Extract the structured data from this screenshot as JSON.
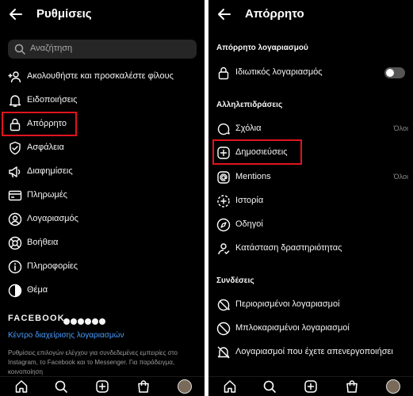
{
  "left": {
    "title": "Ρυθμίσεις",
    "search_placeholder": "Αναζήτηση",
    "items": [
      {
        "label": "Ακολουθήστε και προσκαλέστε φίλους",
        "icon": "add-person-icon"
      },
      {
        "label": "Ειδοποιήσεις",
        "icon": "bell-icon"
      },
      {
        "label": "Απόρρητο",
        "icon": "lock-icon"
      },
      {
        "label": "Ασφάλεια",
        "icon": "shield-icon"
      },
      {
        "label": "Διαφημίσεις",
        "icon": "megaphone-icon"
      },
      {
        "label": "Πληρωμές",
        "icon": "card-icon"
      },
      {
        "label": "Λογαριασμός",
        "icon": "account-icon"
      },
      {
        "label": "Βοήθεια",
        "icon": "lifebuoy-icon"
      },
      {
        "label": "Πληροφορίες",
        "icon": "info-icon"
      },
      {
        "label": "Θέμα",
        "icon": "theme-icon"
      }
    ],
    "facebook_label": "FACEBOOK",
    "accounts_center_link": "Κέντρο διαχείρισης λογαριασμών",
    "footer_note": "Ρυθμίσεις επιλογών ελέγχου για συνδεδεμένες εμπειρίες στο Instagram, το Facebook και το Messenger. Για παράδειγμα, κοινοποίηση"
  },
  "right": {
    "title": "Απόρρητο",
    "section_account": "Απόρρητο λογαριασμού",
    "private_account": "Ιδιωτικός λογαριασμός",
    "private_account_on": false,
    "section_interactions": "Αλληλεπιδράσεις",
    "interactions": [
      {
        "label": "Σχόλια",
        "value": "Όλοι",
        "icon": "comment-icon"
      },
      {
        "label": "Δημοσιεύσεις",
        "value": "",
        "icon": "plus-square-icon"
      },
      {
        "label": "Mentions",
        "value": "Όλοι",
        "icon": "at-icon"
      },
      {
        "label": "Ιστορία",
        "value": "",
        "icon": "story-icon"
      },
      {
        "label": "Οδηγοί",
        "value": "",
        "icon": "guide-icon"
      },
      {
        "label": "Κατάσταση δραστηριότητας",
        "value": "",
        "icon": "activity-icon"
      }
    ],
    "section_connections": "Συνδέσεις",
    "connections": [
      {
        "label": "Περιορισμένοι λογαριασμοί",
        "icon": "restricted-icon"
      },
      {
        "label": "Μπλοκαρισμένοι λογαριασμοί",
        "icon": "blocked-icon"
      },
      {
        "label": "Λογαριασμοί που έχετε απενεργοποιήσει",
        "icon": "muted-icon"
      }
    ]
  },
  "bottom_nav": [
    "home-icon",
    "search-icon",
    "create-icon",
    "shop-icon",
    "profile-avatar"
  ],
  "colors": {
    "background": "#000000",
    "highlight": "#e0141e",
    "link": "#4a9eff"
  }
}
